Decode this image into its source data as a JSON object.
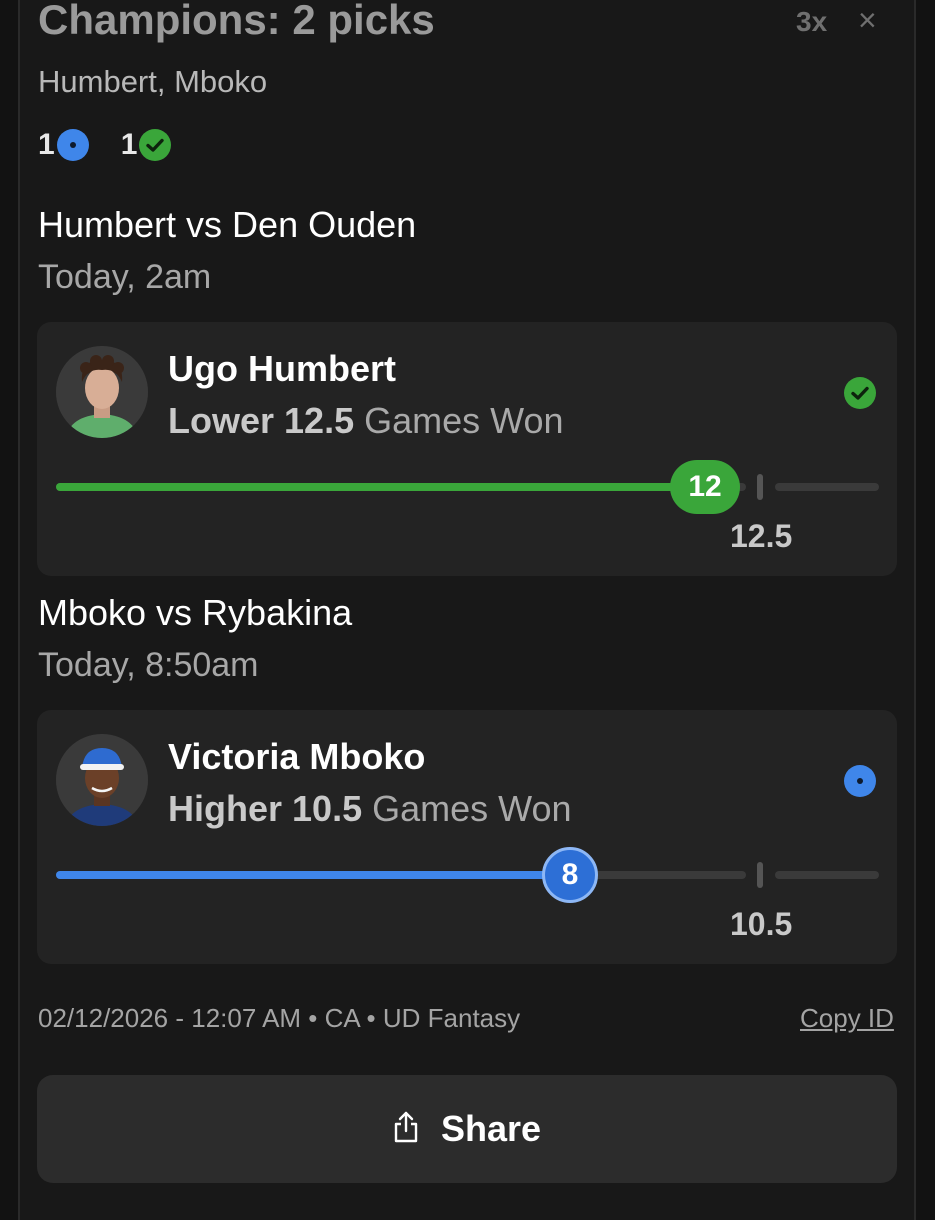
{
  "header": {
    "title": "Champions: 2 picks",
    "multiplier": "3x",
    "close_glyph": "×",
    "players": "Humbert, Mboko"
  },
  "status_counts": {
    "pending": "1",
    "won": "1"
  },
  "matches": [
    {
      "title": "Humbert vs Den Ouden",
      "time": "Today, 2am",
      "player": "Ugo Humbert",
      "direction": "Lower",
      "line": "12.5",
      "stat": "Games Won",
      "current": "12",
      "line_label": "12.5",
      "status": "won",
      "progress_fraction": 0.96,
      "color": "#3aa63a"
    },
    {
      "title": "Mboko vs Rybakina",
      "time": "Today, 8:50am",
      "player": "Victoria Mboko",
      "direction": "Higher",
      "line": "10.5",
      "stat": "Games Won",
      "current": "8",
      "line_label": "10.5",
      "status": "pending",
      "progress_fraction": 0.76,
      "color": "#3f86ea"
    }
  ],
  "footer": {
    "meta": "02/12/2026 - 12:07 AM • CA • UD Fantasy",
    "copy_id": "Copy ID"
  },
  "share": {
    "label": "Share",
    "icon": "share-icon"
  }
}
